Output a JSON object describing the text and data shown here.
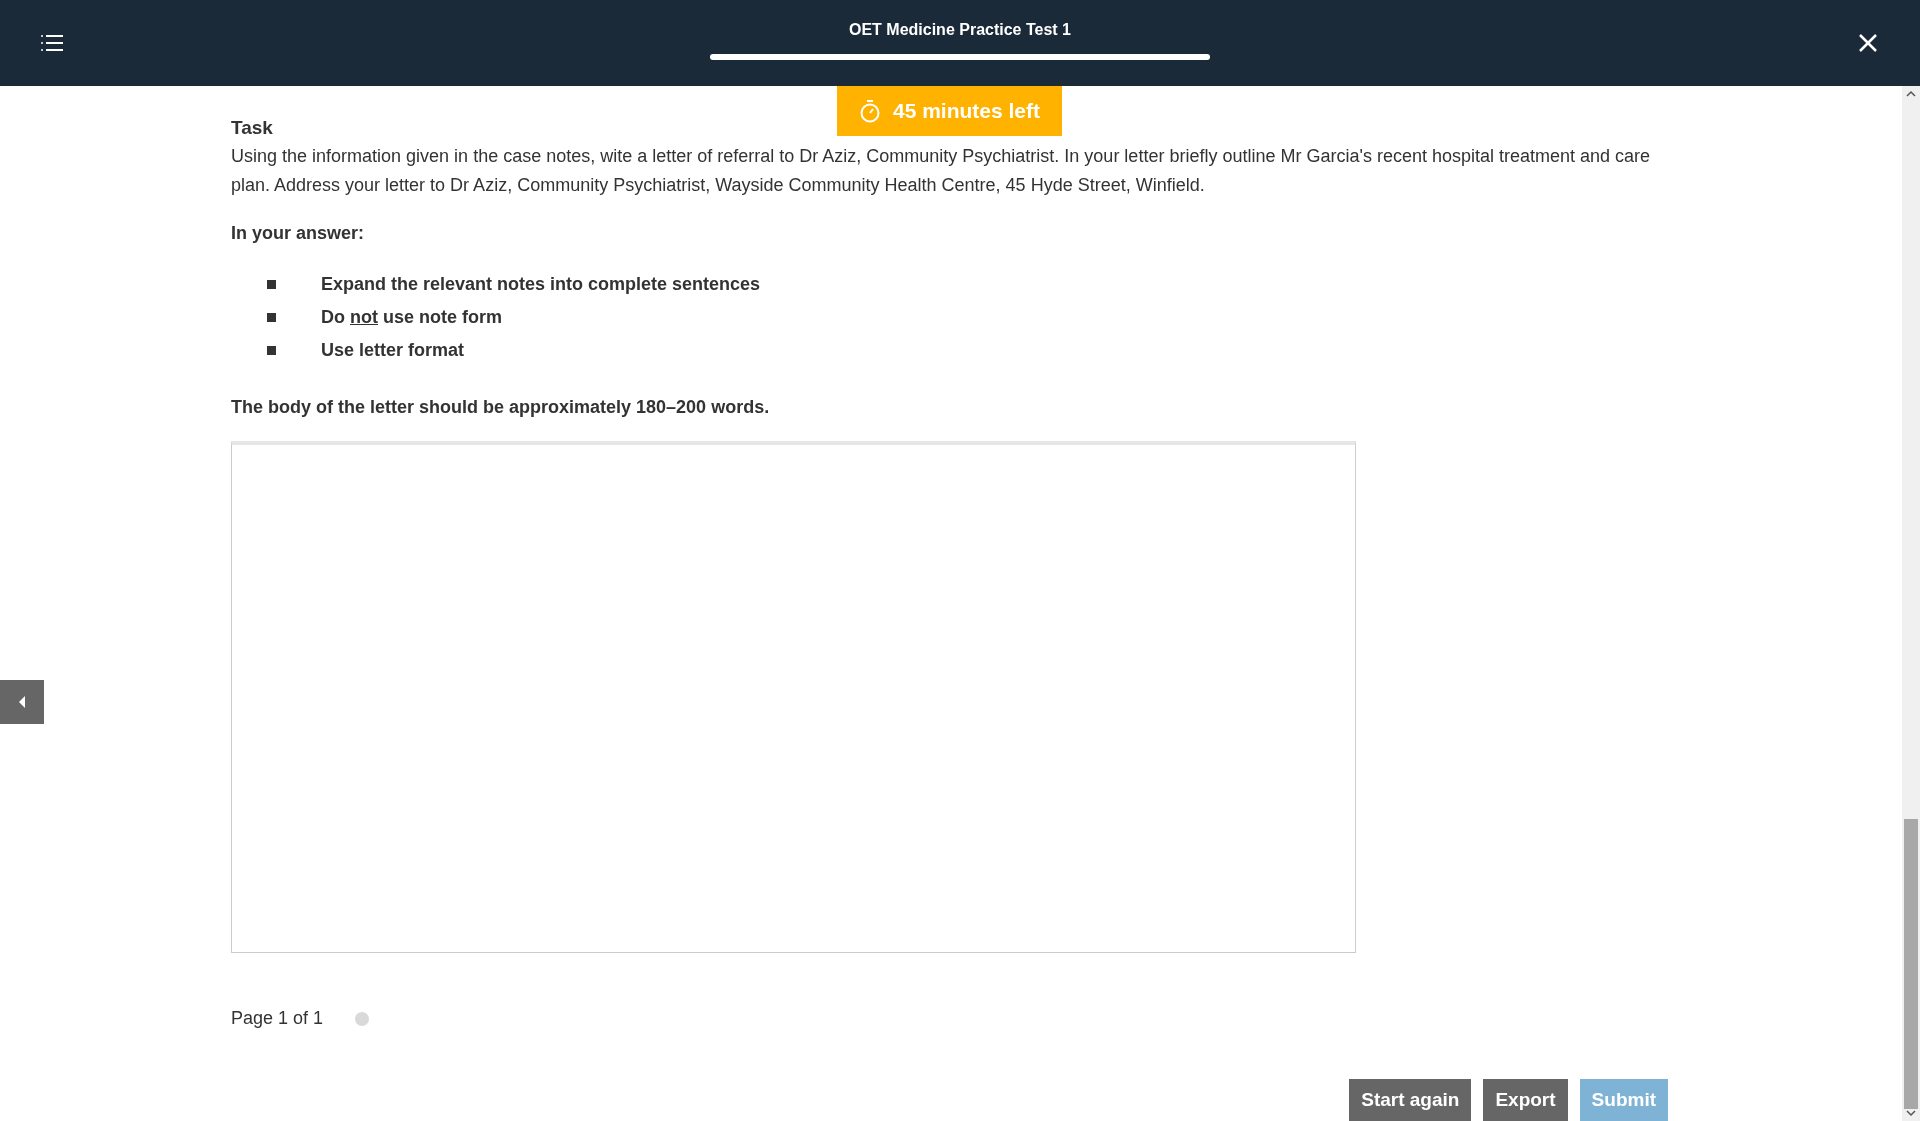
{
  "header": {
    "title": "OET Medicine Practice Test 1",
    "progress": {
      "level": 1
    }
  },
  "timer": {
    "text": "45 minutes left"
  },
  "task": {
    "heading": "Task",
    "body": "Using the information given in the case notes, wite a letter of referral to Dr Aziz, Community Psychiatrist. In your letter briefly outline Mr Garcia's recent hospital treatment and care plan. Address your letter to Dr Aziz, Community Psychiatrist, Wayside Community Health Centre, 45 Hyde Street, Winfield.",
    "answer_heading": "In your answer:",
    "bullets": [
      {
        "parts": [
          {
            "text": "Expand the relevant notes into complete sentences",
            "underline": false
          }
        ]
      },
      {
        "parts": [
          {
            "text": "Do ",
            "underline": false
          },
          {
            "text": "not",
            "underline": true
          },
          {
            "text": " use note form",
            "underline": false
          }
        ]
      },
      {
        "parts": [
          {
            "text": "Use letter format",
            "underline": false
          }
        ]
      }
    ],
    "word_count_note": "The body of the letter should be approximately 180–200 words."
  },
  "pagination": {
    "text": "Page 1 of 1",
    "dots": [
      {
        "selected": false
      }
    ]
  },
  "buttons": [
    {
      "label": "Start again",
      "disabled": false
    },
    {
      "label": "Export",
      "disabled": false
    },
    {
      "label": "Submit",
      "disabled": true
    }
  ]
}
